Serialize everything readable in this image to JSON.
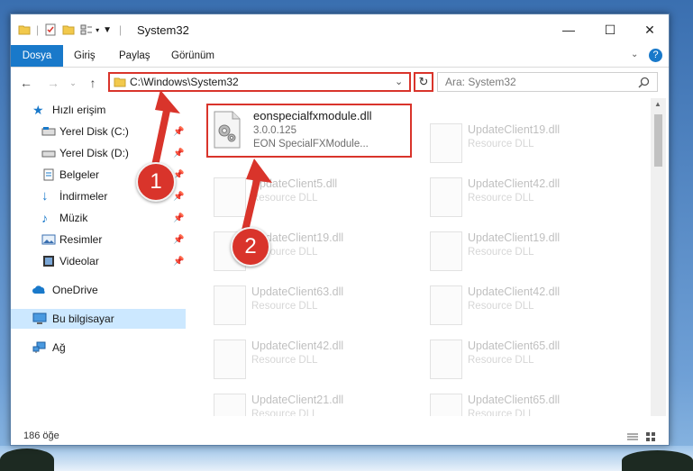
{
  "window": {
    "title": "System32"
  },
  "ribbon": {
    "tabs": [
      {
        "label": "Dosya"
      },
      {
        "label": "Giriş"
      },
      {
        "label": "Paylaş"
      },
      {
        "label": "Görünüm"
      }
    ]
  },
  "address": {
    "path": "C:\\Windows\\System32"
  },
  "search": {
    "placeholder": "Ara: System32"
  },
  "sidebar": {
    "items": [
      {
        "label": "Hızlı erişim",
        "icon": "star-icon"
      },
      {
        "label": "Yerel Disk (C:)",
        "icon": "drive-icon"
      },
      {
        "label": "Yerel Disk (D:)",
        "icon": "drive-icon"
      },
      {
        "label": "Belgeler",
        "icon": "documents-icon"
      },
      {
        "label": "İndirmeler",
        "icon": "download-icon"
      },
      {
        "label": "Müzik",
        "icon": "music-icon"
      },
      {
        "label": "Resimler",
        "icon": "pictures-icon"
      },
      {
        "label": "Videolar",
        "icon": "videos-icon"
      },
      {
        "label": "OneDrive",
        "icon": "cloud-icon"
      },
      {
        "label": "Bu bilgisayar",
        "icon": "computer-icon"
      },
      {
        "label": "Ağ",
        "icon": "network-icon"
      }
    ]
  },
  "files": {
    "highlighted": {
      "name": "eonspecialfxmodule.dll",
      "version": "3.0.0.125",
      "description": "EON SpecialFXModule..."
    },
    "left": [
      {
        "name": "UpdateClient5.dll",
        "sub": "Resource DLL"
      },
      {
        "name": "UpdateClient19.dll",
        "sub": "Resource DLL"
      },
      {
        "name": "UpdateClient63.dll",
        "sub": "Resource DLL"
      },
      {
        "name": "UpdateClient42.dll",
        "sub": "Resource DLL"
      },
      {
        "name": "UpdateClient21.dll",
        "sub": "Resource DLL"
      }
    ],
    "right": [
      {
        "name": "UpdateClient19.dll",
        "sub": "Resource DLL"
      },
      {
        "name": "UpdateClient42.dll",
        "sub": "Resource DLL"
      },
      {
        "name": "UpdateClient19.dll",
        "sub": "Resource DLL"
      },
      {
        "name": "UpdateClient42.dll",
        "sub": "Resource DLL"
      },
      {
        "name": "UpdateClient65.dll",
        "sub": "Resource DLL"
      },
      {
        "name": "UpdateClient65.dll",
        "sub": "Resource DLL"
      }
    ]
  },
  "status": {
    "count": "186 öğe"
  },
  "callouts": [
    {
      "label": "1"
    },
    {
      "label": "2"
    }
  ],
  "colors": {
    "accent": "#1979ca",
    "annotation": "#d9342b",
    "selected": "#cce8ff"
  }
}
